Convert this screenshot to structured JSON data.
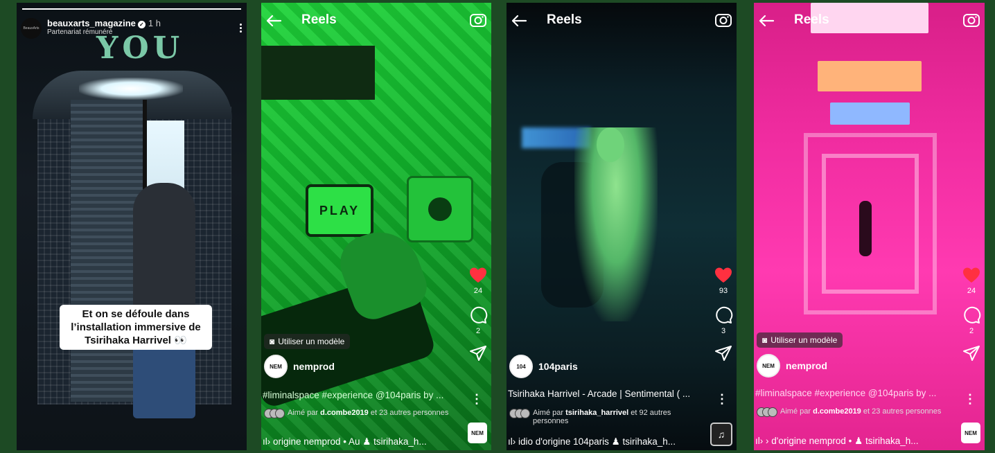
{
  "story": {
    "username": "beauxarts_magazine",
    "time": "1 h",
    "subtitle": "Partenariat rémunéré",
    "avatar_text": "BeauxArts",
    "scene_text": "YOU",
    "sticker_text": "Et on se défoule dans l’installation immersive de Tsirihaka Harrivel 👀",
    "progress": 1.0
  },
  "reels": [
    {
      "title": "Reels",
      "scene_label": "PLAY",
      "likes": "24",
      "comments": "2",
      "model_chip": "Utiliser un modèle",
      "username": "nemprod",
      "avatar_text": "NEM",
      "caption": "#liminalspace #experience @104paris by ...",
      "liked_prefix": "Aimé par",
      "liked_user": "d.combe2019",
      "liked_suffix": "et 23 autres personnes",
      "audio": "ıl› origine  nemprod  •  Au  ♟ tsirihaka_h...",
      "audio_thumb": "NEM"
    },
    {
      "title": "Reels",
      "likes": "93",
      "comments": "3",
      "username": "104paris",
      "avatar_text": "104",
      "caption": "Tsirihaka Harrivel - Arcade | Sentimental ( ...",
      "liked_prefix": "Aimé par",
      "liked_user": "tsirihaka_harrivel",
      "liked_suffix": "et 92 autres personnes",
      "audio": "ıl› idio d'origine  104paris  ♟ tsirihaka_h...",
      "audio_thumb": "♫"
    },
    {
      "title": "Reels",
      "likes": "24",
      "comments": "2",
      "model_chip": "Utiliser un modèle",
      "username": "nemprod",
      "avatar_text": "NEM",
      "caption": "#liminalspace #experience @104paris by ...",
      "liked_prefix": "Aimé par",
      "liked_user": "d.combe2019",
      "liked_suffix": "et 23 autres personnes",
      "audio": "ıl› › d'origine  nemprod  •  ♟ tsirihaka_h...",
      "audio_thumb": "NEM"
    }
  ],
  "colors": {
    "background": "#1d4a24",
    "heart": "#ff3040",
    "panel2_tint": "#1fd43a",
    "panel4_tint": "#ff3ab1"
  }
}
